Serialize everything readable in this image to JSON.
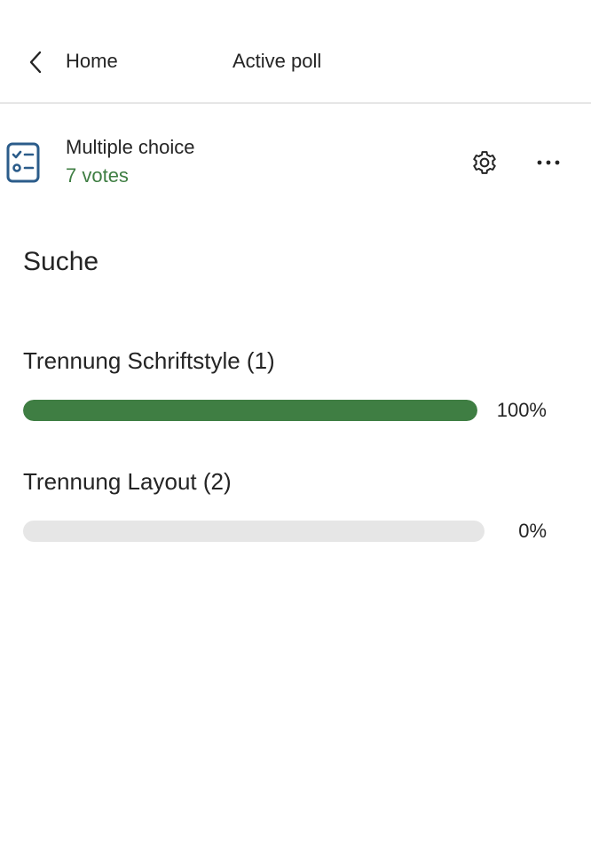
{
  "header": {
    "back_label": "Home",
    "title": "Active poll"
  },
  "poll": {
    "type_label": "Multiple choice",
    "votes_label": "7 votes",
    "question": "Suche",
    "options": [
      {
        "label": "Trennung Schriftstyle (1)",
        "percent_label": "100%",
        "fraction": 1.0
      },
      {
        "label": "Trennung Layout (2)",
        "percent_label": "0%",
        "fraction": 0.0
      }
    ]
  },
  "icons": {
    "back": "chevron-left-icon",
    "poll_type": "checklist-icon",
    "settings": "gear-icon",
    "more": "more-horizontal-icon"
  },
  "colors": {
    "accent_green": "#3f7e43",
    "track_gray": "#e6e6e6",
    "icon_blue": "#2b5c8a",
    "text": "#242424"
  }
}
